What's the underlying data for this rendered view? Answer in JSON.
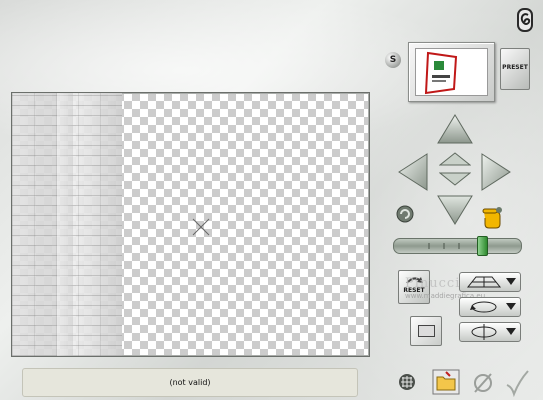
{
  "status": {
    "text": "(not valid)"
  },
  "preset": {
    "button_label": "PRESET",
    "s_label": "S"
  },
  "controls": {
    "reset_label": "RESET"
  },
  "watermark": {
    "name": "Pinuccia",
    "url": "www.maddiegrafica.eu"
  },
  "icons": {
    "logo": "script-e-icon",
    "randomize": "randomize-icon",
    "hand": "pointing-hand-icon",
    "grid": "grid-icon",
    "folder": "open-folder-icon",
    "cancel": "cancel-icon",
    "ok": "checkmark-icon"
  },
  "colors": {
    "arrow": "#b9c2b9",
    "slider_thumb": "#3a9a3a",
    "status_bg": "#e6e6dc"
  }
}
